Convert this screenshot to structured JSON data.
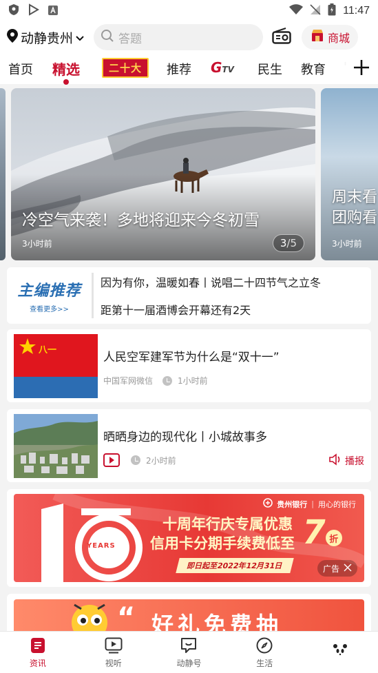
{
  "status_bar": {
    "time": "11:47"
  },
  "header": {
    "location": "动静贵州",
    "search_placeholder": "答题",
    "mall_label": "商城"
  },
  "tabs": [
    {
      "label": "首页"
    },
    {
      "label": "精选"
    },
    {
      "label": "二十大"
    },
    {
      "label": "推荐"
    },
    {
      "label": "G",
      "suffix": "TV"
    },
    {
      "label": "民生"
    },
    {
      "label": "教育"
    },
    {
      "label": "'"
    }
  ],
  "carousel": {
    "main": {
      "title": "冷空气来袭！多地将迎来今冬初雪",
      "time": "3小时前",
      "page_current": "3",
      "page_total": "/5"
    },
    "next": {
      "title_line1": "周末看",
      "title_line2": "团购看",
      "time": "3小时前"
    }
  },
  "editor_pick": {
    "logo_text": "主编推荐",
    "logo_sub": "查看更多>>",
    "items": [
      "因为有你，温暖如春丨说唱二十四节气之立冬",
      "距第十一届酒博会开幕还有2天"
    ]
  },
  "news": [
    {
      "title": "人民空军建军节为什么是“双十一”",
      "source": "中国军网微信",
      "time": "1小时前",
      "flag_text": "八一"
    },
    {
      "title": "晒晒身边的现代化丨小城故事多",
      "time": "2小时前",
      "report_label": "播报"
    }
  ],
  "ad": {
    "bank_name": "贵州银行",
    "bank_slogan": "用心的银行",
    "years_label": "YEARS",
    "headline1": "十周年行庆专属优惠",
    "headline2": "信用卡分期手续费低至",
    "discount": "7",
    "discount_unit": "折",
    "date_text": "即日起至2022年12月31日",
    "ad_label": "广告"
  },
  "ad2": {
    "text": "好礼免费抽"
  },
  "bottom_nav": [
    {
      "label": "资讯"
    },
    {
      "label": "视听"
    },
    {
      "label": "动静号"
    },
    {
      "label": "生活"
    },
    {
      "label": ""
    }
  ],
  "colors": {
    "brand": "#c8102e"
  }
}
